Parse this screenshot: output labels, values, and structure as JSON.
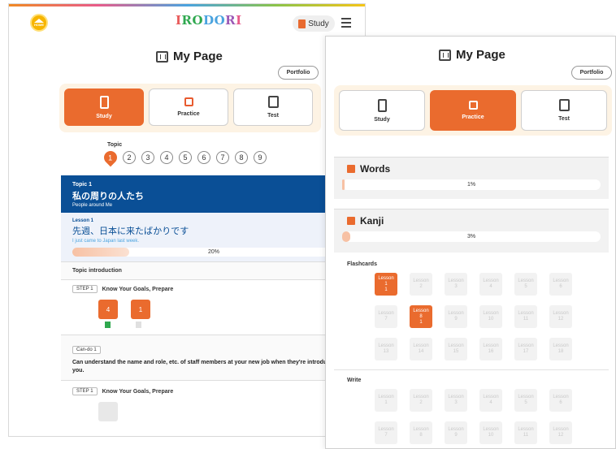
{
  "left": {
    "home_label": "HOME",
    "logo_letters": [
      "I",
      "RO",
      "DO",
      "R",
      "I",
      ""
    ],
    "study_button": "Study",
    "title": "My Page",
    "portfolio": "Portfolio",
    "modes": [
      {
        "label": "Study",
        "active": true
      },
      {
        "label": "Practice",
        "active": false
      },
      {
        "label": "Test",
        "active": false
      }
    ],
    "topic_label": "Topic",
    "topics": [
      "1",
      "2",
      "3",
      "4",
      "5",
      "6",
      "7",
      "8",
      "9"
    ],
    "topic_header": {
      "number": "Topic 1",
      "title": "私の周りの人たち",
      "subtitle": "People around Me"
    },
    "lesson": {
      "number": "Lesson 1",
      "title": "先週、日本に来たばかりです",
      "subtitle": "I just came to Japan last week.",
      "progress_text": "20%",
      "progress": 0.2
    },
    "topic_intro": "Topic introduction",
    "step1": {
      "tag": "STEP 1",
      "label": "Know Your Goals, Prepare",
      "tiles": [
        "4",
        "1"
      ]
    },
    "cando": {
      "tag": "Can-do 1",
      "text": "Can understand the name and role, etc. of staff members at your new job when they're introduced to you."
    },
    "step2": {
      "tag": "STEP 1",
      "label": "Know Your Goals, Prepare"
    }
  },
  "right": {
    "title": "My Page",
    "portfolio": "Portfolio",
    "modes": [
      {
        "label": "Study",
        "active": false
      },
      {
        "label": "Practice",
        "active": true
      },
      {
        "label": "Test",
        "active": false
      }
    ],
    "words": {
      "title": "Words",
      "progress_text": "1%",
      "progress": 0.01
    },
    "kanji": {
      "title": "Kanji",
      "progress_text": "3%",
      "progress": 0.03
    },
    "flashcards_label": "Flashcards",
    "write_label": "Write",
    "lesson_word": "Lesson",
    "flashcards": [
      {
        "n": "1",
        "badge": "1",
        "active": true
      },
      {
        "n": "2"
      },
      {
        "n": "3"
      },
      {
        "n": "4"
      },
      {
        "n": "5"
      },
      {
        "n": "6"
      },
      {
        "n": "7"
      },
      {
        "n": "8",
        "badge": "1",
        "active": true
      },
      {
        "n": "9"
      },
      {
        "n": "10"
      },
      {
        "n": "11"
      },
      {
        "n": "12"
      },
      {
        "n": "13"
      },
      {
        "n": "14"
      },
      {
        "n": "15"
      },
      {
        "n": "16"
      },
      {
        "n": "17"
      },
      {
        "n": "18"
      }
    ],
    "write": [
      {
        "n": "1"
      },
      {
        "n": "2"
      },
      {
        "n": "3"
      },
      {
        "n": "4"
      },
      {
        "n": "5"
      },
      {
        "n": "6"
      },
      {
        "n": "7"
      },
      {
        "n": "8"
      },
      {
        "n": "9"
      },
      {
        "n": "10"
      },
      {
        "n": "11"
      },
      {
        "n": "12"
      }
    ]
  }
}
